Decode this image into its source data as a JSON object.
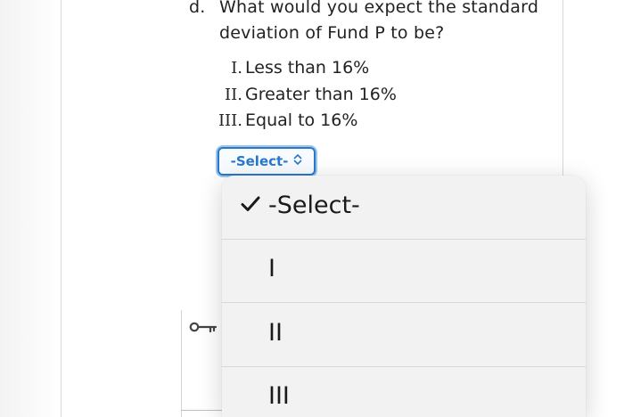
{
  "question": {
    "marker": "d.",
    "text": "What would you expect the standard deviation of Fund P to be?"
  },
  "options": [
    {
      "num": "I.",
      "text": "Less than 16%"
    },
    {
      "num": "II.",
      "text": "Greater than 16%"
    },
    {
      "num": "III.",
      "text": "Equal to 16%"
    }
  ],
  "select": {
    "label": "-Select-",
    "accent_color": "#2a79c8"
  },
  "dropdown": {
    "items": [
      {
        "label": "-Select-",
        "selected": true
      },
      {
        "label": "I",
        "selected": false
      },
      {
        "label": "II",
        "selected": false
      },
      {
        "label": "III",
        "selected": false
      }
    ]
  },
  "icons": {
    "key": "key-icon",
    "check": "checkmark-icon",
    "updown": "updown-chevron-icon"
  }
}
